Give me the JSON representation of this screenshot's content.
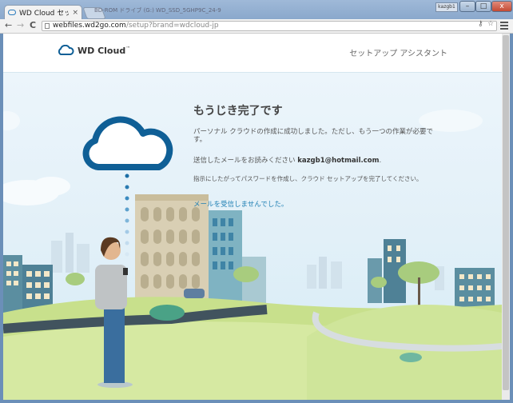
{
  "browser": {
    "tab_title": "WD Cloud セットア",
    "tab_close": "×",
    "background_title": "BD-ROM ドライブ (G:) WD_SSD_5GHP9C_24-9",
    "user_chip": "kazgb1",
    "url_host": "webfiles.wd2go.com",
    "url_path": "/setup?brand=wdcloud-jp",
    "back": "←",
    "forward": "→",
    "reload": "C",
    "minimize": "–",
    "maximize": "□",
    "close": "x"
  },
  "site": {
    "logo_text": "WD Cloud",
    "logo_tm": "™",
    "assistant_label": "セットアップ アシスタント"
  },
  "main": {
    "heading": "もうじき完了です",
    "message": "パーソナル クラウドの作成に成功しました。ただし、もう一つの作業が必要です。",
    "email_prefix": "送信したメールをお読みください ",
    "email": "kazgb1@hotmail.com",
    "email_suffix": ".",
    "instruction": "指示にしたがってパスワードを作成し、クラウド セットアップを完了してください。",
    "not_received_link": "メールを受信しませんでした。"
  },
  "colors": {
    "accent": "#1e7fb3",
    "cloud_blue": "#0f5f96",
    "sky": "#e2f0f8"
  }
}
